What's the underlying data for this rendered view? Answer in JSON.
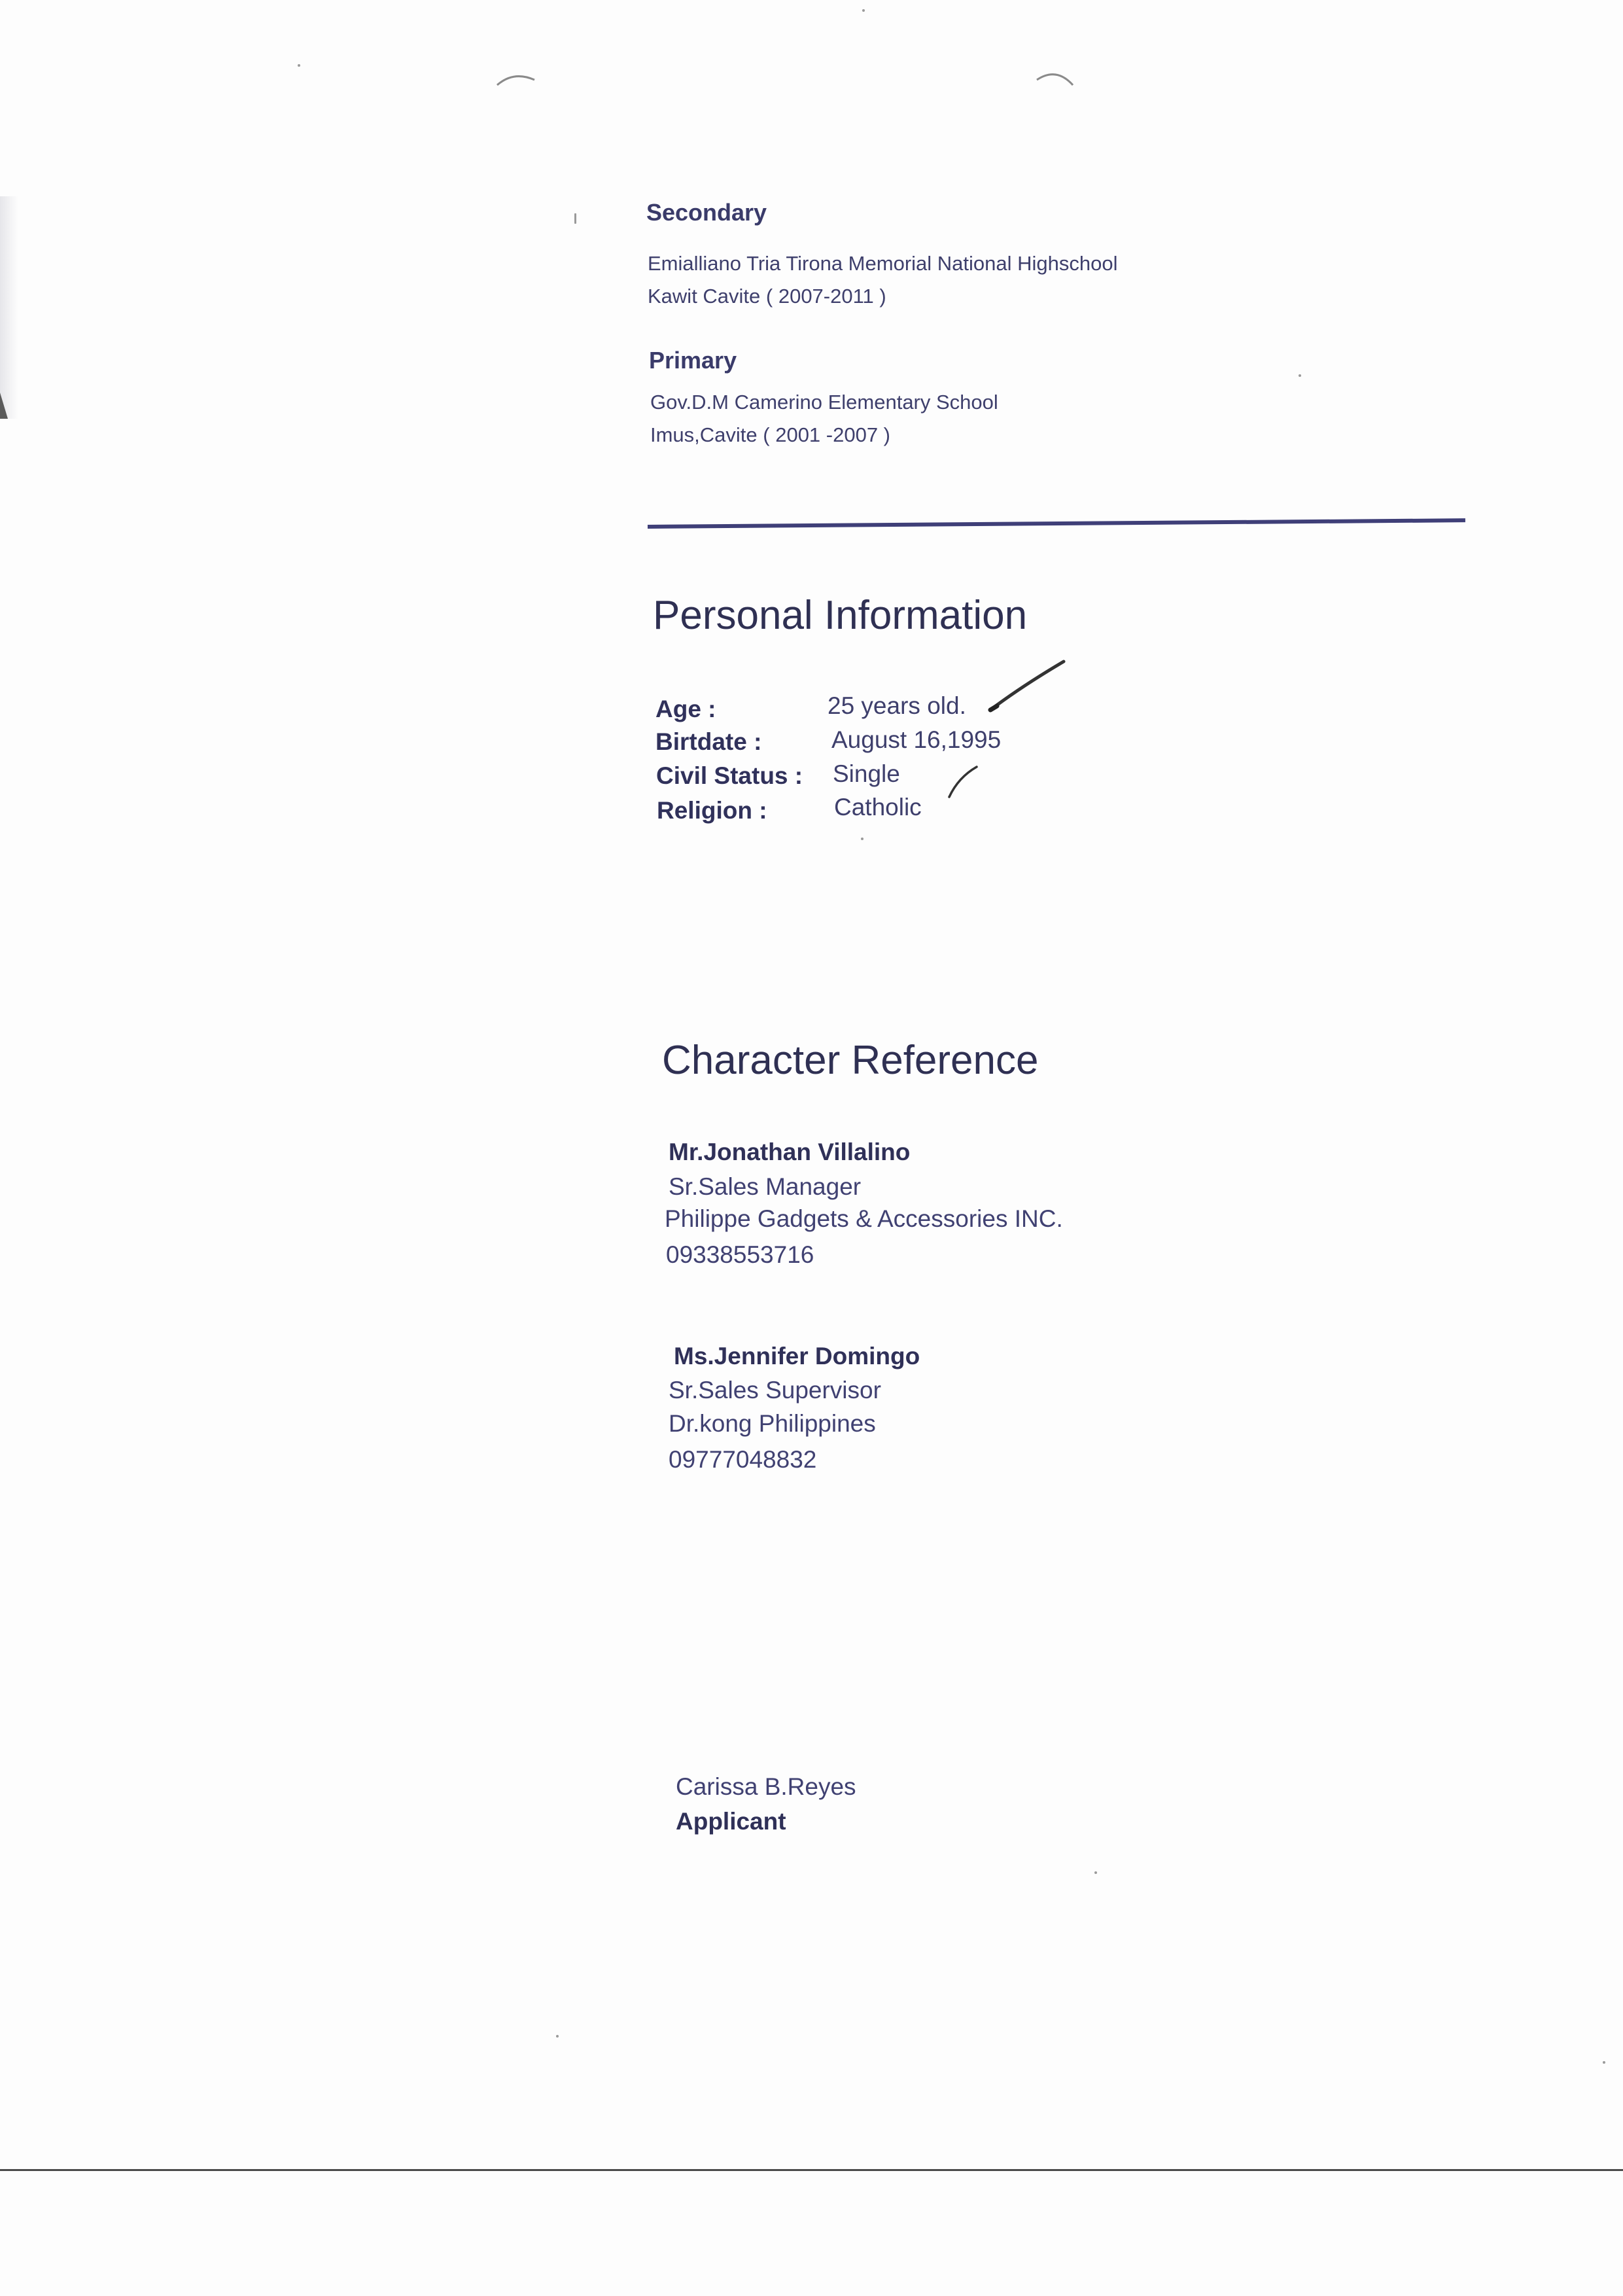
{
  "education": {
    "secondary": {
      "heading": "Secondary",
      "school": "Emialliano Tria Tirona Memorial National Highschool",
      "location_years": "Kawit Cavite ( 2007-2011 )"
    },
    "primary": {
      "heading": "Primary",
      "school": "Gov.D.M Camerino Elementary School",
      "location_years": "Imus,Cavite ( 2001 -2007 )"
    }
  },
  "personal_information": {
    "title": "Personal Information",
    "fields": [
      {
        "label": "Age :",
        "value": "25 years old."
      },
      {
        "label": "Birtdate :",
        "value": "August 16,1995"
      },
      {
        "label": "Civil Status :",
        "value": "Single"
      },
      {
        "label": "Religion :",
        "value": "Catholic"
      }
    ]
  },
  "character_reference": {
    "title": "Character Reference",
    "references": [
      {
        "name": "Mr.Jonathan Villalino",
        "position": "Sr.Sales Manager",
        "company": "Philippe Gadgets & Accessories INC.",
        "phone": "09338553716"
      },
      {
        "name": "Ms.Jennifer Domingo",
        "position": "Sr.Sales Supervisor",
        "company": "Dr.kong Philippines",
        "phone": "09777048832"
      }
    ]
  },
  "signature": {
    "name": "Carissa B.Reyes",
    "role": "Applicant"
  },
  "colors": {
    "text": "#3b3c6e",
    "rule": "#3f3f78",
    "paper": "#fdfdfd"
  }
}
